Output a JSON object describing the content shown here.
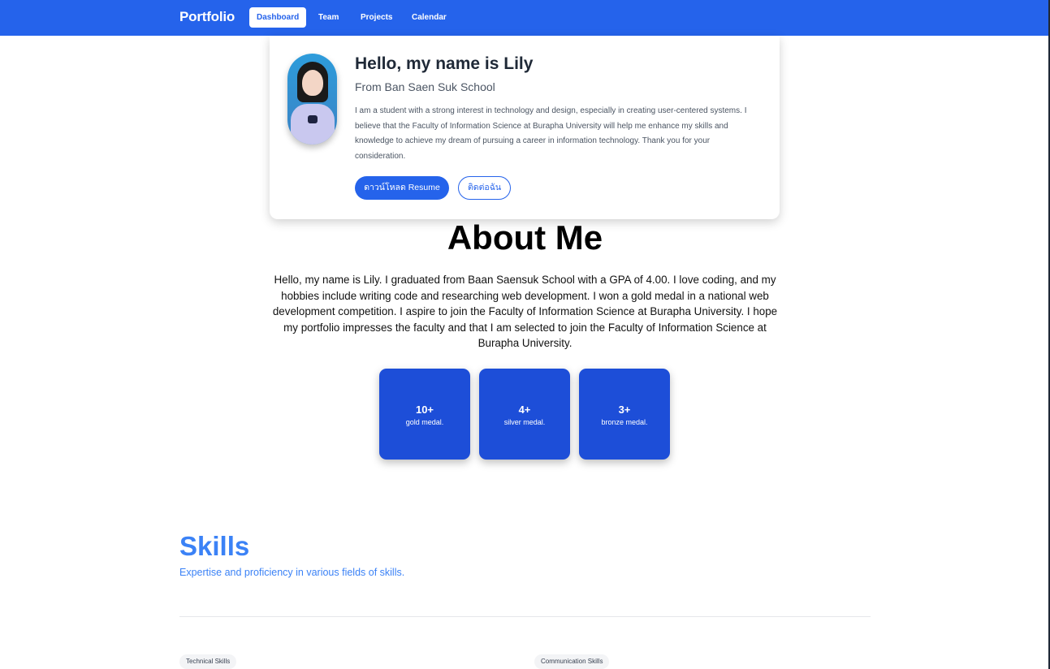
{
  "nav": {
    "brand": "Portfolio",
    "links": [
      "Dashboard",
      "Team",
      "Projects",
      "Calendar"
    ],
    "active": "Dashboard"
  },
  "hero": {
    "title": "Hello, my name is Lily",
    "subtitle": "From Ban Saen Suk School",
    "description": "I am a student with a strong interest in technology and design, especially in creating user-centered systems. I believe that the Faculty of Information Science at Burapha University will help me enhance my skills and knowledge to achieve my dream of pursuing a career in information technology. Thank you for your consideration.",
    "download_button": "ดาวน์โหลด Resume",
    "contact_button": "ติดต่อฉัน"
  },
  "about": {
    "title": "About Me",
    "text": "Hello, my name is Lily. I graduated from Baan Saensuk School with a GPA of 4.00. I love coding, and my hobbies include writing code and researching web development. I won a gold medal in a national web development competition. I aspire to join the Faculty of Information Science at Burapha University. I hope my portfolio impresses the faculty and that I am selected to join the Faculty of Information Science at Burapha University.",
    "stats": [
      {
        "value": "10+",
        "label": "gold medal."
      },
      {
        "value": "4+",
        "label": "silver medal."
      },
      {
        "value": "3+",
        "label": "bronze medal."
      }
    ]
  },
  "skills": {
    "title": "Skills",
    "subtitle": "Expertise and proficiency in various fields of skills.",
    "categories": [
      "Technical Skills",
      "Communication Skills"
    ]
  },
  "colors": {
    "primary": "#2563eb",
    "stat_card": "#1d4ed8",
    "skills_accent": "#3b82f6"
  }
}
